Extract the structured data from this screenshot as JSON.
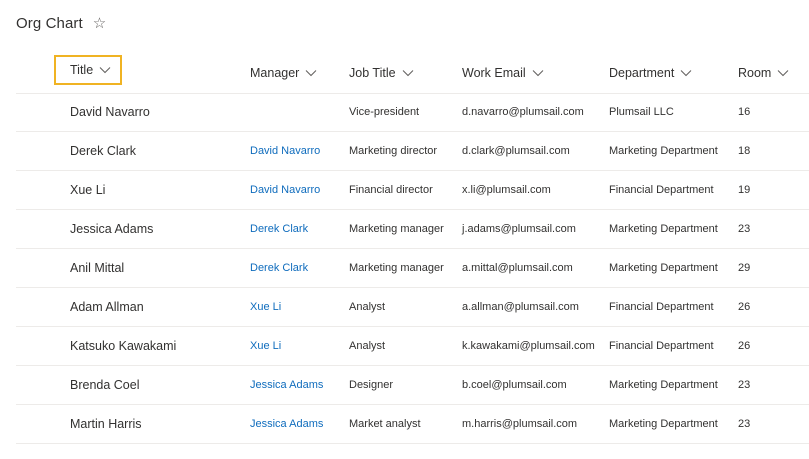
{
  "list": {
    "title": "Org Chart",
    "favorite_icon": "star-outline-icon"
  },
  "columns": [
    {
      "key": "title",
      "label": "Title"
    },
    {
      "key": "manager",
      "label": "Manager"
    },
    {
      "key": "job_title",
      "label": "Job Title"
    },
    {
      "key": "work_email",
      "label": "Work Email"
    },
    {
      "key": "department",
      "label": "Department"
    },
    {
      "key": "room",
      "label": "Room"
    }
  ],
  "colors": {
    "link": "#0f6cbd",
    "highlight_border": "#f0b323"
  },
  "rows": [
    {
      "title": "David Navarro",
      "manager": "",
      "job_title": "Vice-president",
      "work_email": "d.navarro@plumsail.com",
      "department": "Plumsail LLC",
      "room": "16"
    },
    {
      "title": "Derek Clark",
      "manager": "David Navarro",
      "job_title": "Marketing director",
      "work_email": "d.clark@plumsail.com",
      "department": "Marketing Department",
      "room": "18"
    },
    {
      "title": "Xue Li",
      "manager": "David Navarro",
      "job_title": "Financial director",
      "work_email": "x.li@plumsail.com",
      "department": "Financial Department",
      "room": "19"
    },
    {
      "title": "Jessica Adams",
      "manager": "Derek Clark",
      "job_title": "Marketing manager",
      "work_email": "j.adams@plumsail.com",
      "department": "Marketing Department",
      "room": "23"
    },
    {
      "title": "Anil Mittal",
      "manager": "Derek Clark",
      "job_title": "Marketing manager",
      "work_email": "a.mittal@plumsail.com",
      "department": "Marketing Department",
      "room": "29"
    },
    {
      "title": "Adam Allman",
      "manager": "Xue Li",
      "job_title": "Analyst",
      "work_email": "a.allman@plumsail.com",
      "department": "Financial Department",
      "room": "26"
    },
    {
      "title": "Katsuko Kawakami",
      "manager": "Xue Li",
      "job_title": "Analyst",
      "work_email": "k.kawakami@plumsail.com",
      "department": "Financial Department",
      "room": "26"
    },
    {
      "title": "Brenda Coel",
      "manager": "Jessica Adams",
      "job_title": "Designer",
      "work_email": "b.coel@plumsail.com",
      "department": "Marketing Department",
      "room": "23"
    },
    {
      "title": "Martin Harris",
      "manager": "Jessica Adams",
      "job_title": "Market analyst",
      "work_email": "m.harris@plumsail.com",
      "department": "Marketing Department",
      "room": "23"
    }
  ]
}
